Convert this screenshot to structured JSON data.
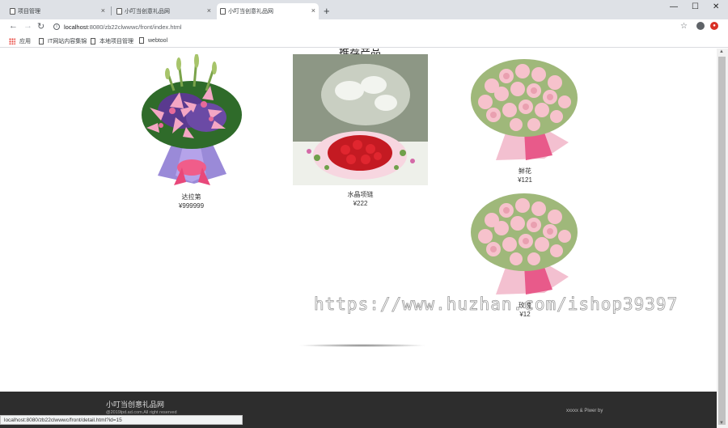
{
  "browser": {
    "tabs": [
      {
        "title": "项目管理",
        "active": false
      },
      {
        "title": "小叮当创意礼品网",
        "active": false
      },
      {
        "title": "小叮当创意礼品网",
        "active": true
      }
    ],
    "close_glyph": "×",
    "new_tab_glyph": "+",
    "window_controls": {
      "minimize": "—",
      "maximize": "☐",
      "close": "✕"
    },
    "url_host": "localhost",
    "url_rest": ":8080/zb22clwwwc/front/index.html",
    "bookmarks": [
      "应用",
      "IT网站内容集锦",
      "本地项目管理",
      "webtool"
    ]
  },
  "page": {
    "section_title": "推荐产品",
    "products": [
      {
        "name": "达拉第",
        "price": "¥999999",
        "image": "lily-bouquet"
      },
      {
        "name": "水晶项链",
        "price": "¥222",
        "image": "roses-gift"
      },
      {
        "name": "鲜花",
        "price": "¥121",
        "image": "pink-carnations"
      },
      {
        "name": "玫瑰",
        "price": "¥12",
        "image": "pink-carnations"
      }
    ],
    "watermark": "https://www.huzhan.com/ishop39397",
    "footer": {
      "title": "小叮当创意礼品网",
      "copyright": "@2019lpd.ad.com.All right reserved",
      "powered": "xxxxx & Piwer by"
    },
    "status_url": "localhost:8080/zb22clwwwc/front/detail.html?id=15"
  }
}
